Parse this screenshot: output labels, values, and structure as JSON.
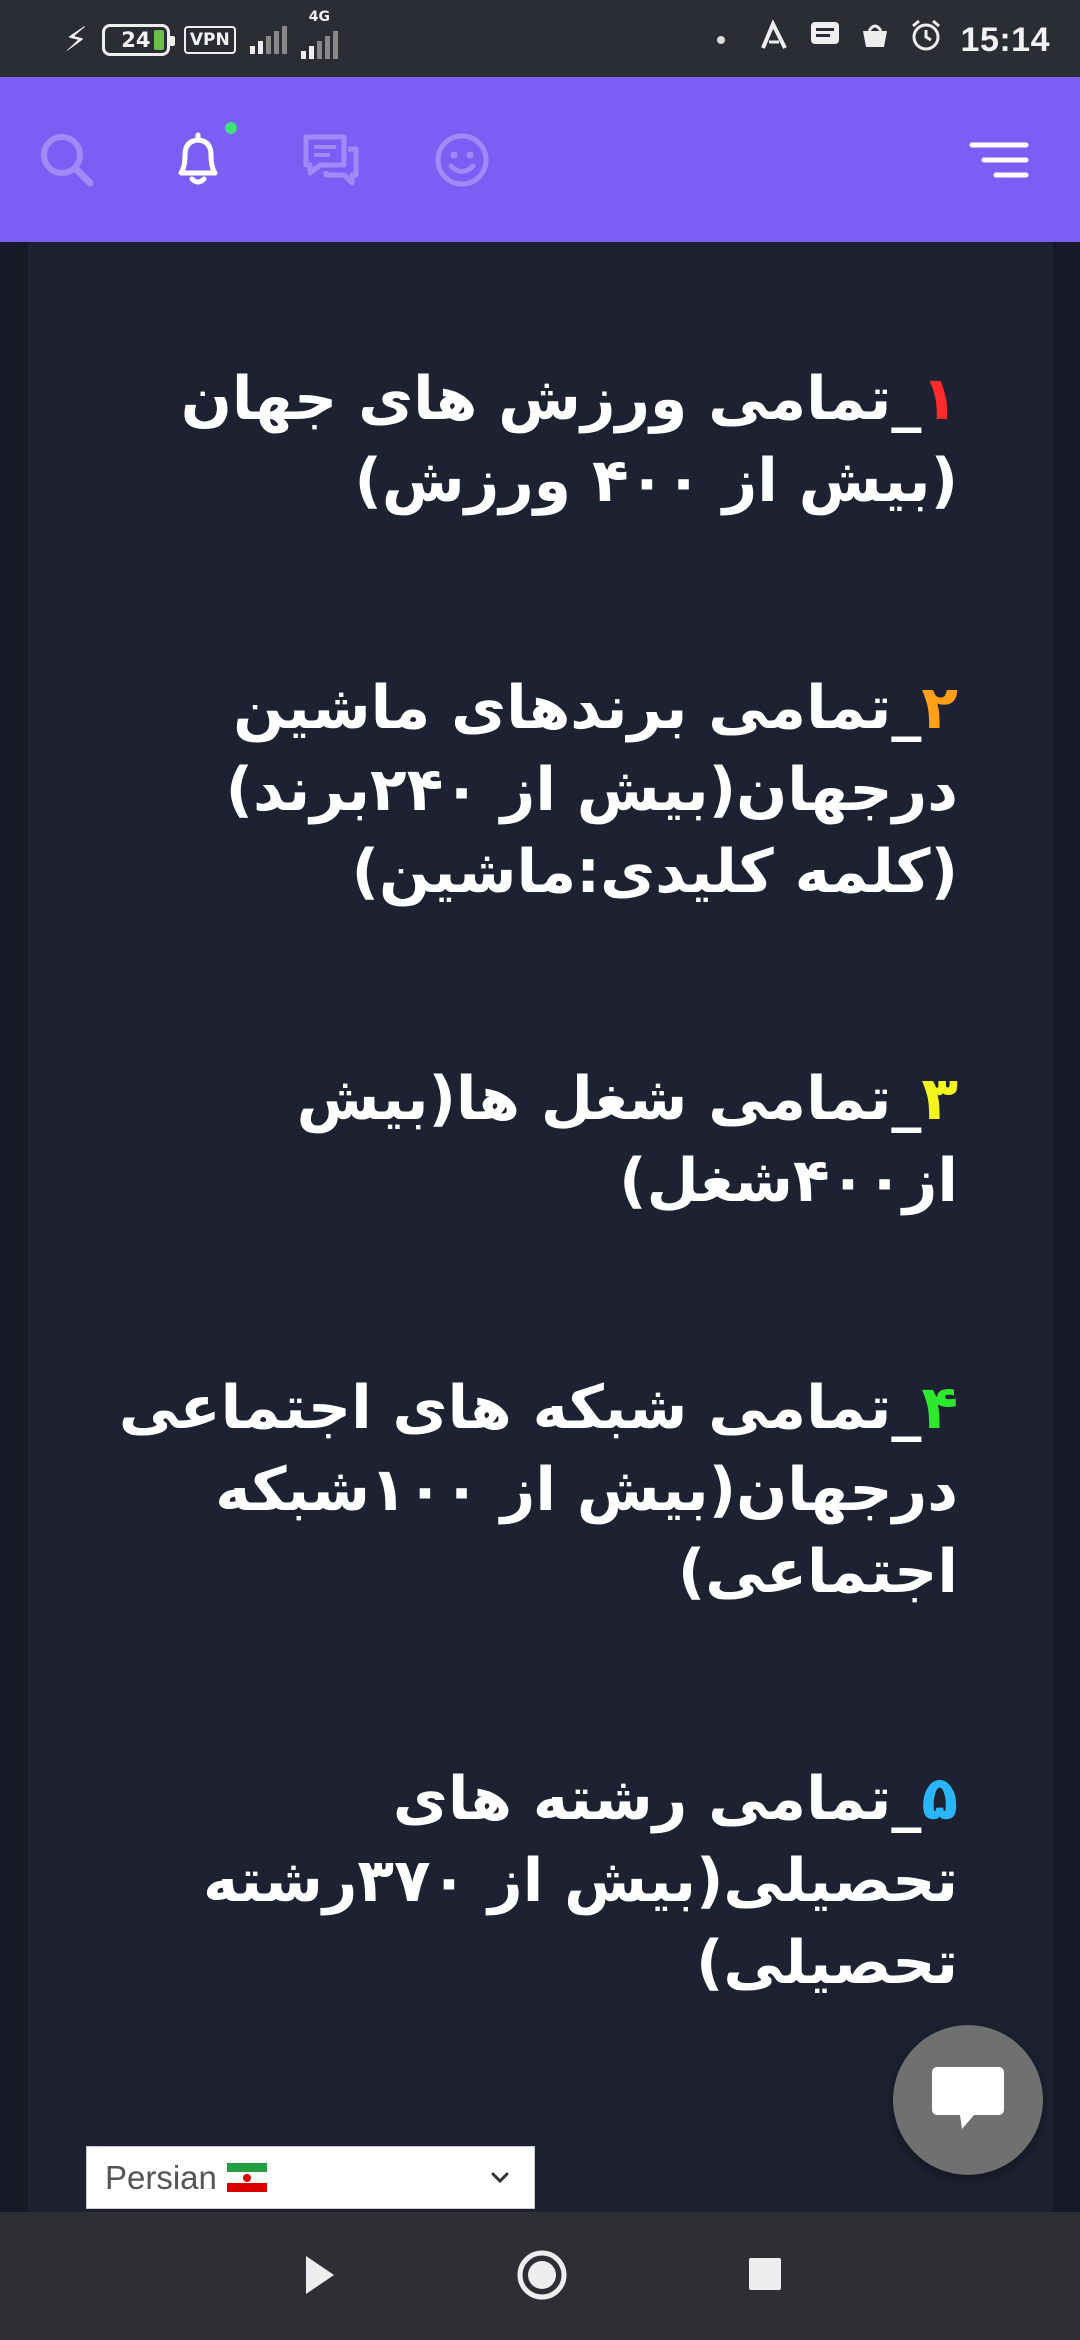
{
  "status_bar": {
    "battery_level": "24",
    "vpn_label": "VPN",
    "network_label": "4G",
    "time": "15:14"
  },
  "app_header": {
    "icons": [
      "menu-icon",
      "smiley-icon",
      "chat-icon",
      "bell-icon",
      "search-icon"
    ],
    "notification_dot_color": "#3ee07a",
    "accent_color": "#7b5ff5"
  },
  "article": {
    "items": [
      {
        "number": "۱",
        "number_color": "#ff2a2a",
        "text": "_تمامی ورزش های جهان (بیش از ۴۰۰ ورزش)"
      },
      {
        "number": "۲",
        "number_color": "#ff9f1a",
        "text": "_تمامی برندهای ماشین درجهان(بیش از ۲۴۰برند) (کلمه کلیدی:ماشین)"
      },
      {
        "number": "۳",
        "number_color": "#f4f41e",
        "text": "_تمامی شغل ها(بیش از۴۰۰شغل)"
      },
      {
        "number": "۴",
        "number_color": "#2ee82e",
        "text": "_تمامی شبکه های اجتماعی درجهان(بیش از ۱۰۰شبکه اجتماعی)"
      },
      {
        "number": "۵",
        "number_color": "#29b6f6",
        "text": "_تمامی رشته های تحصیلی(بیش از ۳۷۰رشته تحصیلی)"
      }
    ]
  },
  "language_selector": {
    "selected": "Persian",
    "flag": "iran-flag-icon"
  },
  "nav_bar": {
    "buttons": [
      "back-icon",
      "home-icon",
      "recents-icon"
    ]
  }
}
